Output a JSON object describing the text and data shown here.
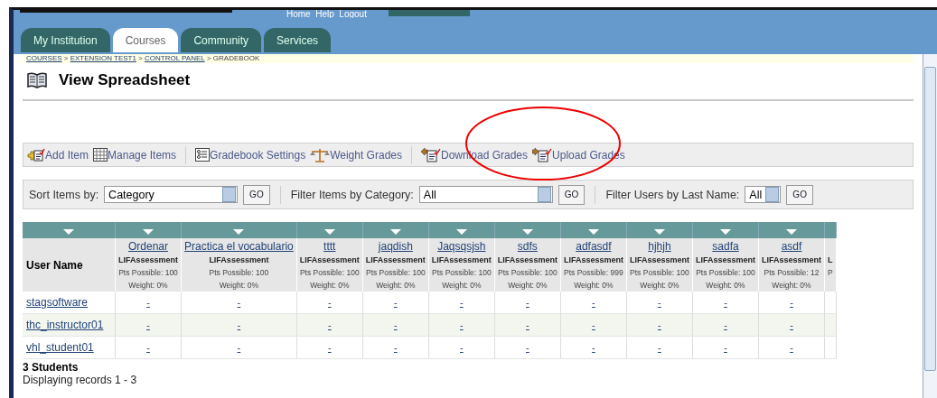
{
  "header": {
    "top_links": "Home  Help  Logout",
    "tabs": [
      {
        "label": "My Institution",
        "selected": false
      },
      {
        "label": "Courses",
        "selected": true
      },
      {
        "label": "Community",
        "selected": false
      },
      {
        "label": "Services",
        "selected": false
      }
    ]
  },
  "breadcrumb": [
    {
      "label": "COURSES",
      "link": true
    },
    {
      "label": " > ",
      "link": false
    },
    {
      "label": "EXTENSION TEST1",
      "link": true
    },
    {
      "label": " > ",
      "link": false
    },
    {
      "label": "CONTROL PANEL",
      "link": true
    },
    {
      "label": " > GRADEBOOK",
      "link": false
    }
  ],
  "page_title": "View Spreadsheet",
  "toolbar": [
    {
      "kind": "add",
      "label": "Add Item",
      "group_end": false
    },
    {
      "kind": "manage",
      "label": "Manage Items",
      "group_end": true
    },
    {
      "kind": "settings",
      "label": "Gradebook Settings",
      "group_end": false
    },
    {
      "kind": "weight",
      "label": "Weight Grades",
      "group_end": true
    },
    {
      "kind": "download",
      "label": "Download Grades",
      "group_end": false
    },
    {
      "kind": "upload",
      "label": "Upload Grades",
      "group_end": false
    }
  ],
  "filters": [
    {
      "label": "Sort Items by:",
      "value": "Category",
      "kind": "list",
      "button": "GO"
    },
    {
      "label": "Filter Items by Category:",
      "value": "All",
      "kind": "list",
      "button": "GO"
    },
    {
      "label": "Filter Users by Last Name:",
      "value": "All",
      "kind": "letter",
      "button": "GO"
    }
  ],
  "table": {
    "user_column": "User Name",
    "columns": [
      {
        "title": "Ordenar",
        "type": "LIFAssessment",
        "points": "Pts Possible: 100",
        "weight": "Weight: 0%"
      },
      {
        "title": "Practica el vocabulario",
        "type": "LIFAssessment",
        "points": "Pts Possible: 100",
        "weight": "Weight: 0%"
      },
      {
        "title": "tttt",
        "type": "LIFAssessment",
        "points": "Pts Possible: 100",
        "weight": "Weight: 0%"
      },
      {
        "title": "jaqdish",
        "type": "LIFAssessment",
        "points": "Pts Possible: 100",
        "weight": "Weight: 0%"
      },
      {
        "title": "Jaqsqsjsh",
        "type": "LIFAssessment",
        "points": "Pts Possible: 100",
        "weight": "Weight: 0%"
      },
      {
        "title": "sdfs",
        "type": "LIFAssessment",
        "points": "Pts Possible: 100",
        "weight": "Weight: 0%"
      },
      {
        "title": "adfasdf",
        "type": "LIFAssessment",
        "points": "Pts Possible: 999",
        "weight": "Weight: 0%"
      },
      {
        "title": "hjhjh",
        "type": "LIFAssessment",
        "points": "Pts Possible: 100",
        "weight": "Weight: 0%"
      },
      {
        "title": "sadfa",
        "type": "LIFAssessment",
        "points": "Pts Possible: 100",
        "weight": "Weight: 0%"
      },
      {
        "title": "asdf",
        "type": "LIFAssessment",
        "points": "Pts Possible: 12",
        "weight": "Weight: 0%"
      },
      {
        "type": "L",
        "points": "P"
      }
    ],
    "rows": [
      {
        "user": "stagsoftware",
        "cells": [
          "-",
          "-",
          "-",
          "-",
          "-",
          "-",
          "-",
          "-",
          "-",
          "-"
        ]
      },
      {
        "user": "thc_instructor01",
        "cells": [
          "-",
          "-",
          "-",
          "-",
          "-",
          "-",
          "-",
          "-",
          "-",
          "-"
        ]
      },
      {
        "user": "vhl_student01",
        "cells": [
          "-",
          "-",
          "-",
          "-",
          "-",
          "-",
          "-",
          "-",
          "-",
          "-"
        ]
      }
    ]
  },
  "footer": {
    "count": "3 Students",
    "records": "Displaying records 1 - 3"
  }
}
